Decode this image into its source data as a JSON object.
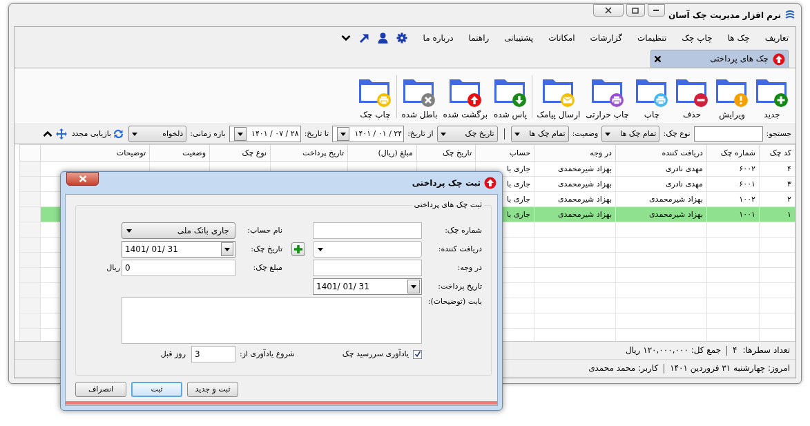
{
  "window": {
    "title": "نرم افزار مدیریت چک آسان"
  },
  "menu": [
    "تعاریف",
    "چک ها",
    "چاپ چک",
    "تنظیمات",
    "گزارشات",
    "امکانات",
    "پشتیبانی",
    "راهنما",
    "درباره ما"
  ],
  "tabs": [
    {
      "label": "چک های پرداختی",
      "selected": true
    }
  ],
  "toolbar_groups": [
    [
      {
        "label": "جدید",
        "color": "#138a13"
      },
      {
        "label": "ویرایش",
        "color": "#f5a000"
      },
      {
        "label": "حذف",
        "color": "#d0203c"
      },
      {
        "label": "چاپ",
        "color": "#4ab8f0"
      },
      {
        "label": "چاپ حرارتی",
        "color": "#9a4fd0"
      },
      {
        "label": "ارسال پیامک",
        "color": "#f5c000"
      }
    ],
    [
      {
        "label": "پاس شده",
        "color": "#1a8a1a"
      },
      {
        "label": "برگشت شده",
        "color": "#e81010"
      },
      {
        "label": "باطل شده",
        "color": "#808080"
      }
    ],
    [
      {
        "label": "چاپ چک",
        "color": "#f5c000"
      }
    ]
  ],
  "filters": {
    "search_label": "جستجو:",
    "type_label": "نوع چک:",
    "type_value": "تمام چک ها",
    "status_label": "وضعیت:",
    "status_value": "تمام چک ها",
    "date_field": "تاریخ چک",
    "from_label": "از تاریخ:",
    "from_value": "۱۴۰۱ / ۰۱ / ۲۴",
    "to_label": "تا تاریخ:",
    "to_value": "۱۴۰۱ / ۰۷ / ۲۸",
    "range_label": "بازه زمانی:",
    "range_value": "دلخواه",
    "refresh": "بازیابی مجدد"
  },
  "table": {
    "columns": [
      "کد چک",
      "شماره چک",
      "دریافت کننده",
      "در وجه",
      "حساب",
      "تاریخ چک",
      "مبلغ (ریال)",
      "تاریخ پرداخت",
      "نوع چک",
      "وضعیت",
      "توضیحات"
    ],
    "rows": [
      {
        "cells": [
          "۴",
          "۶۰۰۲",
          "مهدی نادری",
          "بهزاد شیرمحمدی",
          "جاری با"
        ],
        "selected": false
      },
      {
        "cells": [
          "۳",
          "۶۰۰۱",
          "مهدی نادری",
          "بهزاد شیرمحمدی",
          "جاری با"
        ],
        "selected": false
      },
      {
        "cells": [
          "۲",
          "۱۰۰۲",
          "بهزاد شیرمحمدی",
          "بهزاد شیرمحمدی",
          "جاری با"
        ],
        "selected": false
      },
      {
        "cells": [
          "۱",
          "۱۰۰۱",
          "بهزاد شیرمحمدی",
          "بهزاد شیرمحمدی",
          "جاری با"
        ],
        "selected": true
      }
    ]
  },
  "status_bar": {
    "row_count_label": "تعداد سطرها:",
    "row_count": "۴",
    "total": "جمع کل: ۱۲۰,۰۰۰,۰۰۰ ریال",
    "today": "امروز: چهارشنبه ۳۱ فروردین ۱۴۰۱",
    "user": "کاربر: محمد محمدی"
  },
  "dialog": {
    "title": "ثبت چک پرداختی",
    "group": "ثبت چک های پرداختی",
    "check_number": {
      "label": "شماره چک:"
    },
    "payee": {
      "label": "دریافت کننده:"
    },
    "pay_to": {
      "label": "در وجه:"
    },
    "payment_date": {
      "label": "تاریخ پرداخت:",
      "value": "1401/ 01/ 31"
    },
    "description": {
      "label": "بابت (توضیحات):"
    },
    "reminder": {
      "label": "یادآوری سررسید چک",
      "checked": true
    },
    "account": {
      "label": "نام حساب:",
      "value": "جاری بانک ملی"
    },
    "check_date": {
      "label": "تاریخ چک:",
      "value": "1401/ 01/ 31"
    },
    "amount": {
      "label": "مبلغ چک:",
      "value": "0",
      "unit": "ریال"
    },
    "reminder_start": {
      "label": "شروع یادآوری از:",
      "value": "3",
      "unit": "روز قبل"
    },
    "buttons": [
      {
        "label": "ثبت و جدید",
        "focused": false
      },
      {
        "label": "ثبت",
        "focused": true
      },
      {
        "label": "انصراف",
        "focused": false
      }
    ]
  }
}
